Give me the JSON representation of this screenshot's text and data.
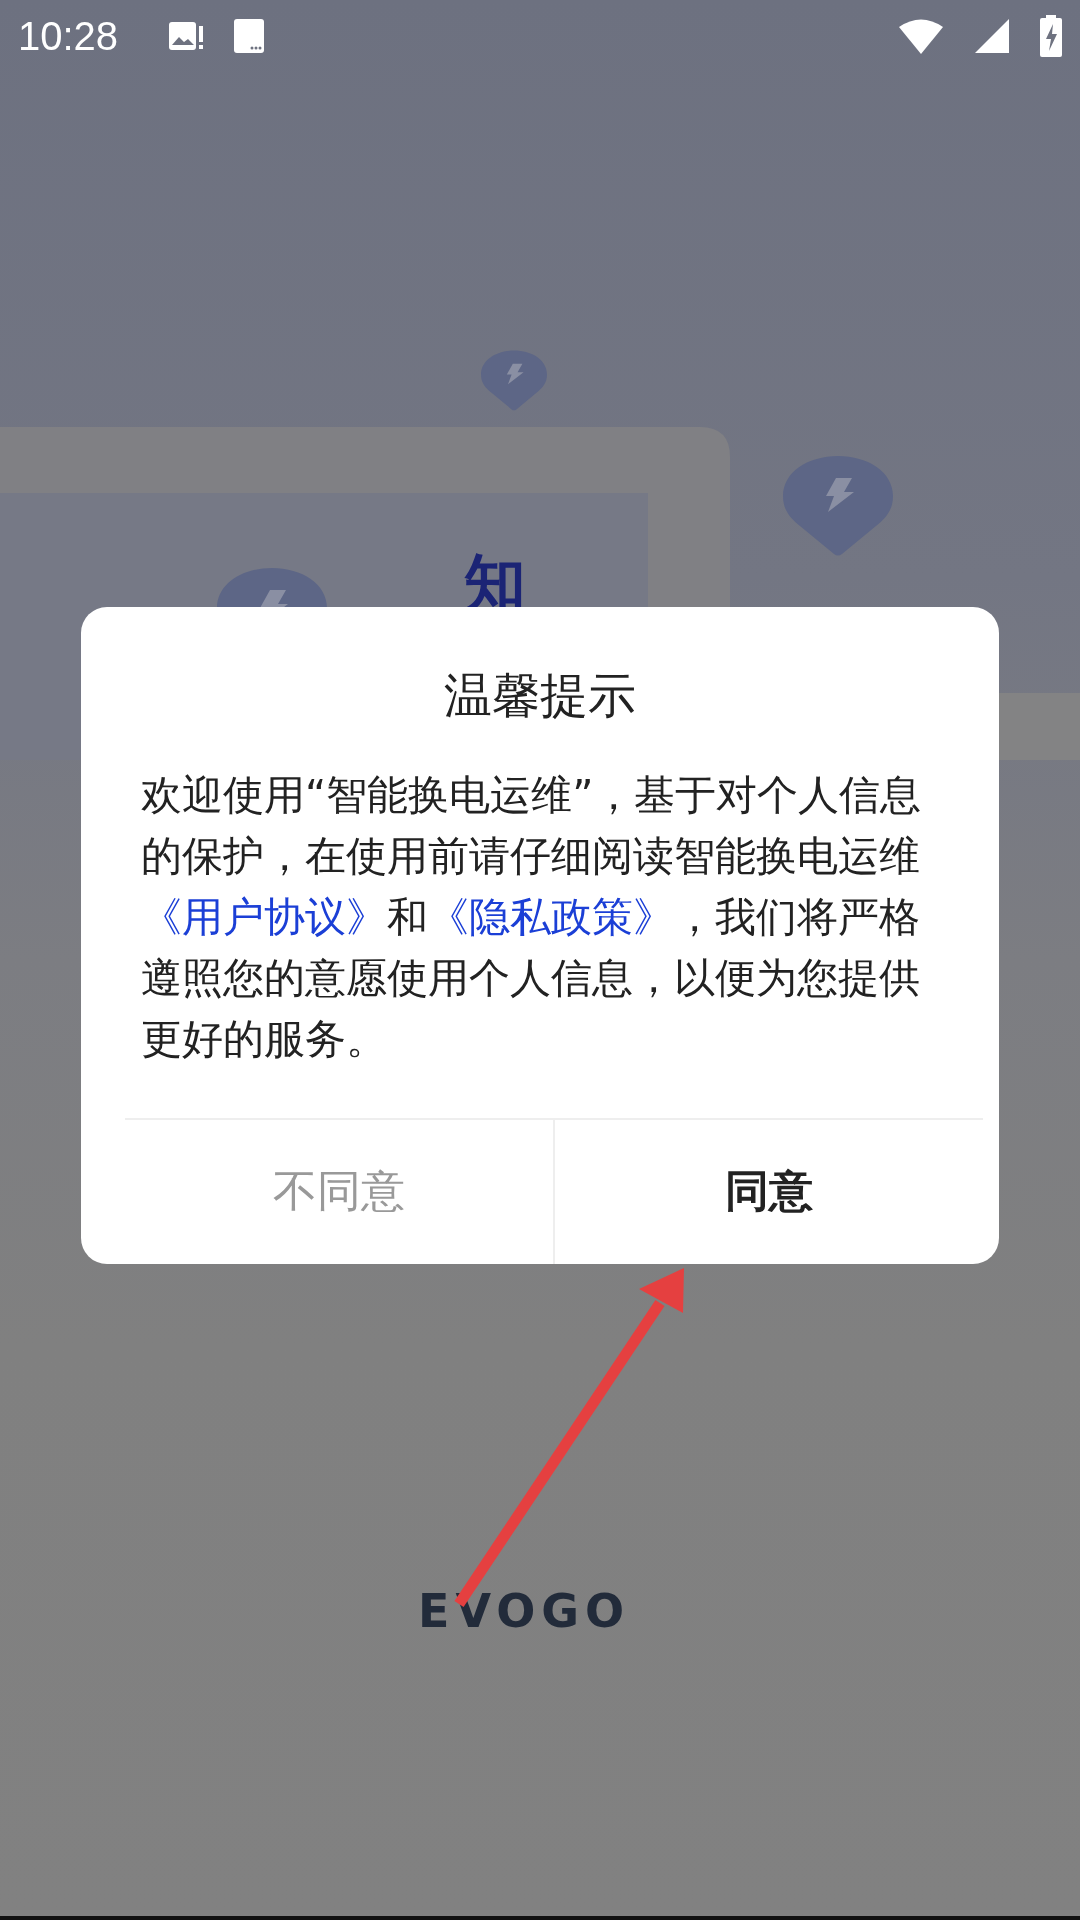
{
  "status_bar": {
    "time": "10:28"
  },
  "background": {
    "headline_fragment": "知",
    "logo": "EVOGO"
  },
  "dialog": {
    "title": "温馨提示",
    "message": [
      {
        "kind": "text",
        "text": "欢迎使用“智能换电运维”，基于对个人信息的保护，在使用前请仔细阅读智能换电运维"
      },
      {
        "kind": "link",
        "text": "《用户协议》"
      },
      {
        "kind": "text",
        "text": "和"
      },
      {
        "kind": "link",
        "text": "《隐私政策》"
      },
      {
        "kind": "text",
        "text": "，我们将严格遵照您的意愿使用个人信息，以便为您提供更好的服务。"
      }
    ],
    "buttons": [
      {
        "label": "不同意",
        "kind": "decline"
      },
      {
        "label": "同意",
        "kind": "accept"
      }
    ]
  },
  "annotation": {
    "kind": "arrow"
  }
}
